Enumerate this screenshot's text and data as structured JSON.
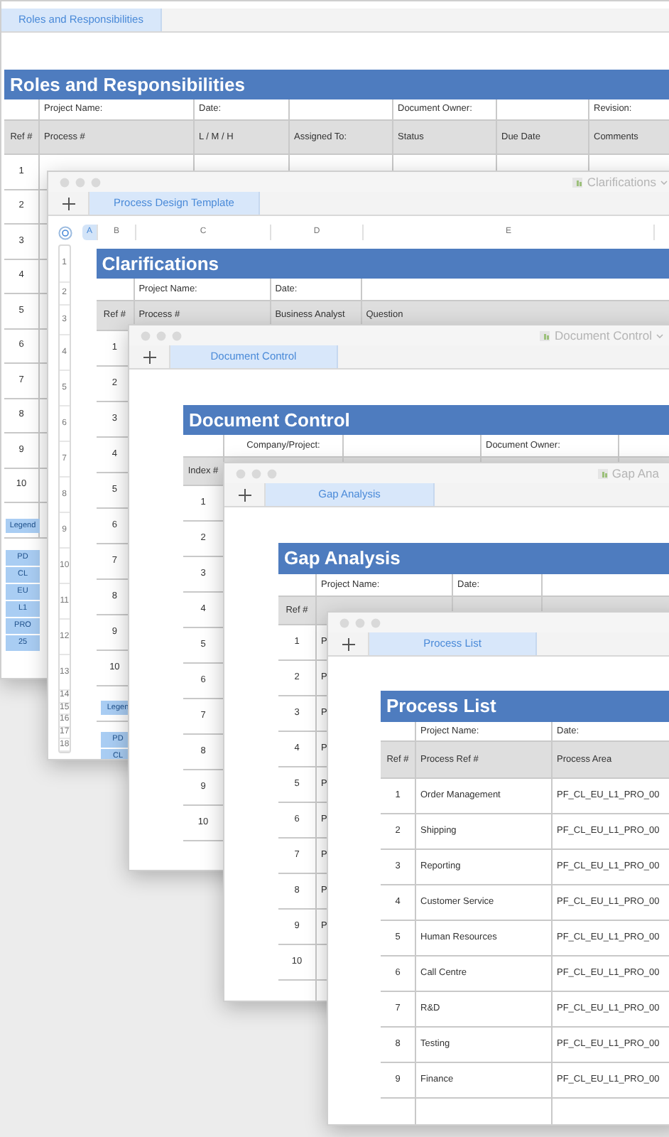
{
  "windows": [
    {
      "kind": "roles",
      "tab": "Roles and Responsibilities",
      "sheet": {
        "title": "Roles and Responsibilities",
        "info": {
          "project": "Project Name:",
          "date": "Date:",
          "owner": "Document Owner:",
          "revision": "Revision:"
        },
        "columns": [
          "Ref #",
          "Process #",
          "L / M / H",
          "Assigned To:",
          "Status",
          "Due Date",
          "Comments"
        ],
        "rows": [
          {
            "ref": "1"
          },
          {
            "ref": "2"
          },
          {
            "ref": "3"
          },
          {
            "ref": "4"
          },
          {
            "ref": "5"
          },
          {
            "ref": "6"
          },
          {
            "ref": "7"
          },
          {
            "ref": "8"
          },
          {
            "ref": "9"
          },
          {
            "ref": "10"
          }
        ],
        "legend": {
          "title": "Legend",
          "keys": [
            "PD",
            "CL",
            "EU",
            "L1",
            "PRO",
            "25"
          ]
        }
      }
    },
    {
      "kind": "clarifications",
      "title": "Clarifications",
      "tab": "Process Design Template",
      "column_letters": [
        {
          "label": "A",
          "selected": true
        },
        {
          "label": "B",
          "selected": false
        },
        {
          "label": "C",
          "selected": false
        },
        {
          "label": "D",
          "selected": false
        },
        {
          "label": "E",
          "selected": false
        }
      ],
      "row_numbers": [
        "1",
        "2",
        "3",
        "4",
        "5",
        "6",
        "7",
        "8",
        "9",
        "10",
        "11",
        "12",
        "13",
        "14",
        "15",
        "16",
        "17",
        "18"
      ],
      "sheet": {
        "title": "Clarifications",
        "info": {
          "project": "Project Name:",
          "date": "Date:"
        },
        "columns": [
          "Ref #",
          "Process #",
          "Business Analyst",
          "Question"
        ],
        "rows": [
          {
            "ref": "1"
          },
          {
            "ref": "2"
          },
          {
            "ref": "3"
          },
          {
            "ref": "4"
          },
          {
            "ref": "5"
          },
          {
            "ref": "6"
          },
          {
            "ref": "7"
          },
          {
            "ref": "8"
          },
          {
            "ref": "9"
          },
          {
            "ref": "10"
          }
        ],
        "legend": {
          "title": "Legen",
          "keys": [
            "PD",
            "CL"
          ]
        }
      }
    },
    {
      "kind": "document_control",
      "title": "Document Control",
      "tab": "Document Control",
      "sheet": {
        "title": "Document Control",
        "info": {
          "company": "Company/Project:",
          "owner": "Document Owner:"
        },
        "columns": [
          "Index #"
        ],
        "rows": [
          {
            "ref": "1"
          },
          {
            "ref": "2"
          },
          {
            "ref": "3"
          },
          {
            "ref": "4"
          },
          {
            "ref": "5"
          },
          {
            "ref": "6"
          },
          {
            "ref": "7"
          },
          {
            "ref": "8"
          },
          {
            "ref": "9"
          },
          {
            "ref": "10"
          }
        ]
      }
    },
    {
      "kind": "gap_analysis",
      "title": "Gap Ana",
      "tab": "Gap Analysis",
      "sheet": {
        "title": "Gap Analysis",
        "info": {
          "project": "Project Name:",
          "date": "Date:"
        },
        "columns": [
          "Ref #"
        ],
        "rows": [
          {
            "ref": "1",
            "process": "P"
          },
          {
            "ref": "2",
            "process": "P"
          },
          {
            "ref": "3",
            "process": "P"
          },
          {
            "ref": "4",
            "process": "P"
          },
          {
            "ref": "5",
            "process": "P"
          },
          {
            "ref": "6",
            "process": "P"
          },
          {
            "ref": "7",
            "process": "P"
          },
          {
            "ref": "8",
            "process": "P"
          },
          {
            "ref": "9",
            "process": "P"
          },
          {
            "ref": "10"
          }
        ]
      }
    },
    {
      "kind": "process_list",
      "tab": "Process List",
      "sheet": {
        "title": "Process List",
        "info": {
          "project": "Project Name:",
          "date": "Date:"
        },
        "columns": [
          "Ref #",
          "Process Ref #",
          "Process Area"
        ],
        "rows": [
          {
            "ref": "1",
            "process": "Order Management",
            "area": "PF_CL_EU_L1_PRO_00"
          },
          {
            "ref": "2",
            "process": "Shipping",
            "area": "PF_CL_EU_L1_PRO_00"
          },
          {
            "ref": "3",
            "process": "Reporting",
            "area": "PF_CL_EU_L1_PRO_00"
          },
          {
            "ref": "4",
            "process": "Customer Service",
            "area": "PF_CL_EU_L1_PRO_00"
          },
          {
            "ref": "5",
            "process": "Human Resources",
            "area": "PF_CL_EU_L1_PRO_00"
          },
          {
            "ref": "6",
            "process": "Call Centre",
            "area": "PF_CL_EU_L1_PRO_00"
          },
          {
            "ref": "7",
            "process": "R&D",
            "area": "PF_CL_EU_L1_PRO_00"
          },
          {
            "ref": "8",
            "process": "Testing",
            "area": "PF_CL_EU_L1_PRO_00"
          },
          {
            "ref": "9",
            "process": "Finance",
            "area": "PF_CL_EU_L1_PRO_00"
          }
        ]
      }
    }
  ]
}
